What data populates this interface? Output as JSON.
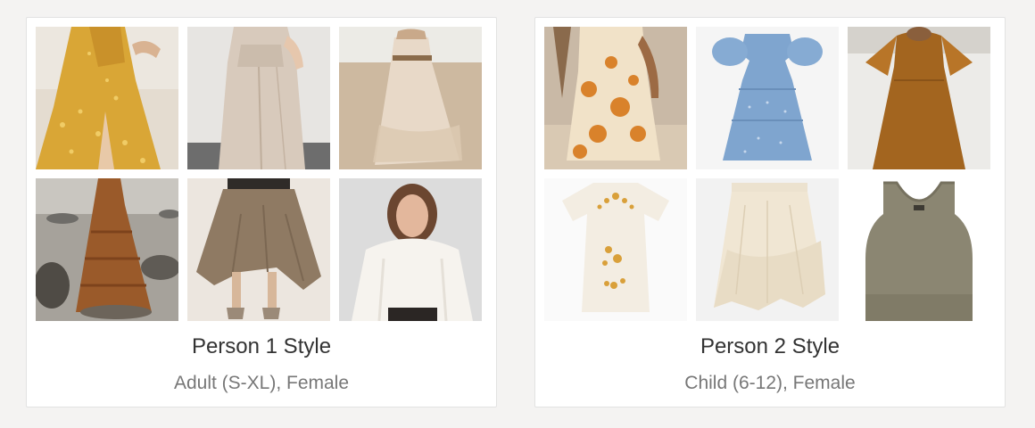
{
  "cards": [
    {
      "title": "Person 1 Style",
      "subtitle": "Adult (S-XL), Female",
      "images": [
        {
          "name": "yellow-floral-maxi-dress-photo"
        },
        {
          "name": "beige-maxi-dress-photo"
        },
        {
          "name": "cream-lace-maxi-dress-photo"
        },
        {
          "name": "rust-tiered-maxi-dress-photo"
        },
        {
          "name": "taupe-high-low-skirt-photo"
        },
        {
          "name": "white-satin-blouse-photo"
        }
      ]
    },
    {
      "title": "Person 2 Style",
      "subtitle": "Child (6-12), Female",
      "images": [
        {
          "name": "orange-floral-child-dress-photo"
        },
        {
          "name": "blue-tiered-child-dress-photo"
        },
        {
          "name": "rust-flutter-sleeve-child-dress-photo"
        },
        {
          "name": "embroidered-white-child-dress-photo"
        },
        {
          "name": "cream-ruffle-skirt-photo"
        },
        {
          "name": "olive-tank-top-photo"
        }
      ]
    }
  ],
  "colors": {
    "page_background": "#f4f3f2",
    "card_background": "#ffffff",
    "card_border": "#e2e2e2",
    "title_text": "#333333",
    "subtitle_text": "#777777"
  }
}
